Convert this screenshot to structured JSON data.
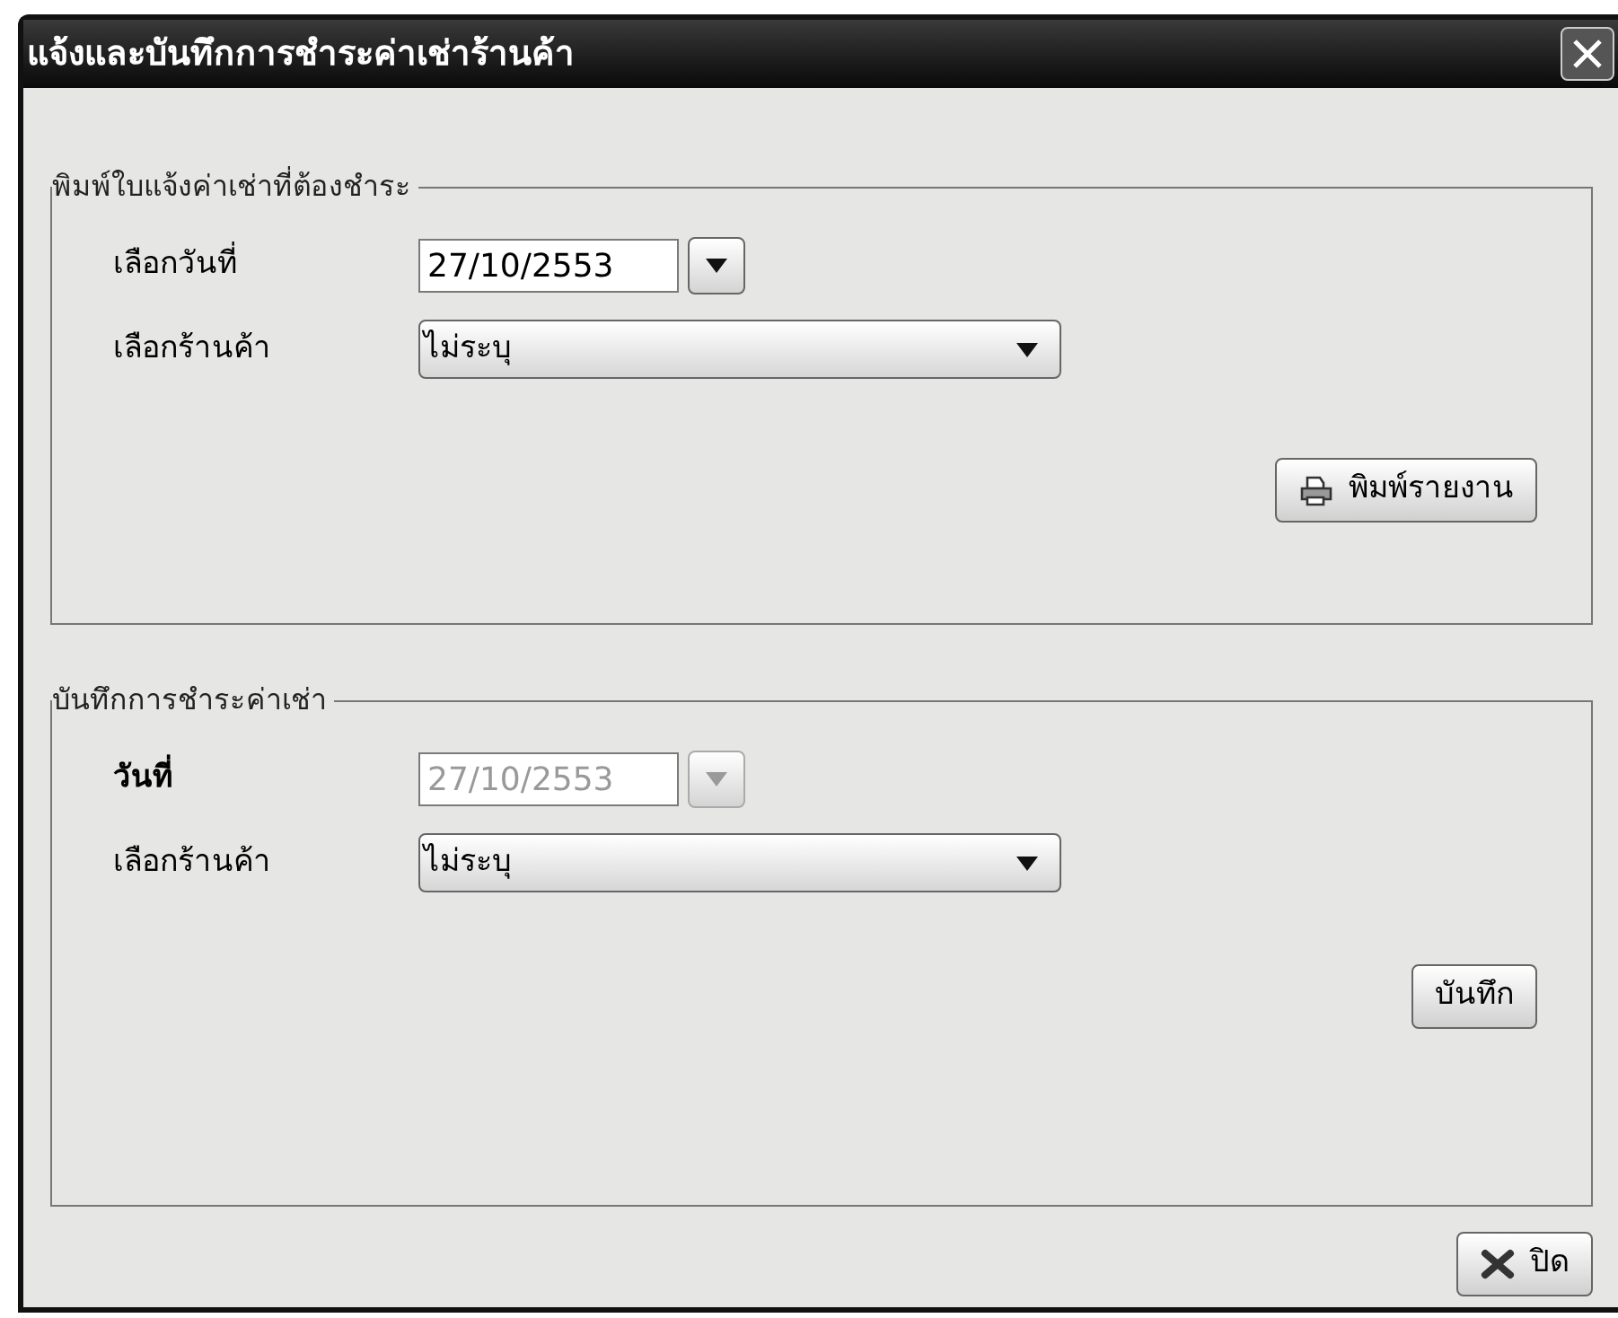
{
  "window": {
    "title": "แจ้งและบันทึกการชำระค่าเช่าร้านค้า"
  },
  "sections": [
    {
      "title": "พิมพ์ใบแจ้งค่าเช่าที่ต้องชำระ",
      "fields": [
        {
          "label": "เลือกวันที่",
          "kind": "date",
          "value": "27/10/2553",
          "disabled": false
        },
        {
          "label": "เลือกร้านค้า",
          "kind": "select",
          "value": "ไม่ระบุ",
          "disabled": false
        }
      ],
      "button": {
        "label": "พิมพ์รายงาน",
        "kind": "print"
      }
    },
    {
      "title": "บันทึกการชำระค่าเช่า",
      "fields": [
        {
          "label": "วันที่",
          "kind": "date",
          "value": "27/10/2553",
          "disabled": true
        },
        {
          "label": "เลือกร้านค้า",
          "kind": "select",
          "value": "ไม่ระบุ",
          "disabled": false
        }
      ],
      "button": {
        "label": "บันทึก",
        "kind": "plain"
      }
    }
  ],
  "footer_button": {
    "label": "ปิด",
    "kind": "close"
  }
}
